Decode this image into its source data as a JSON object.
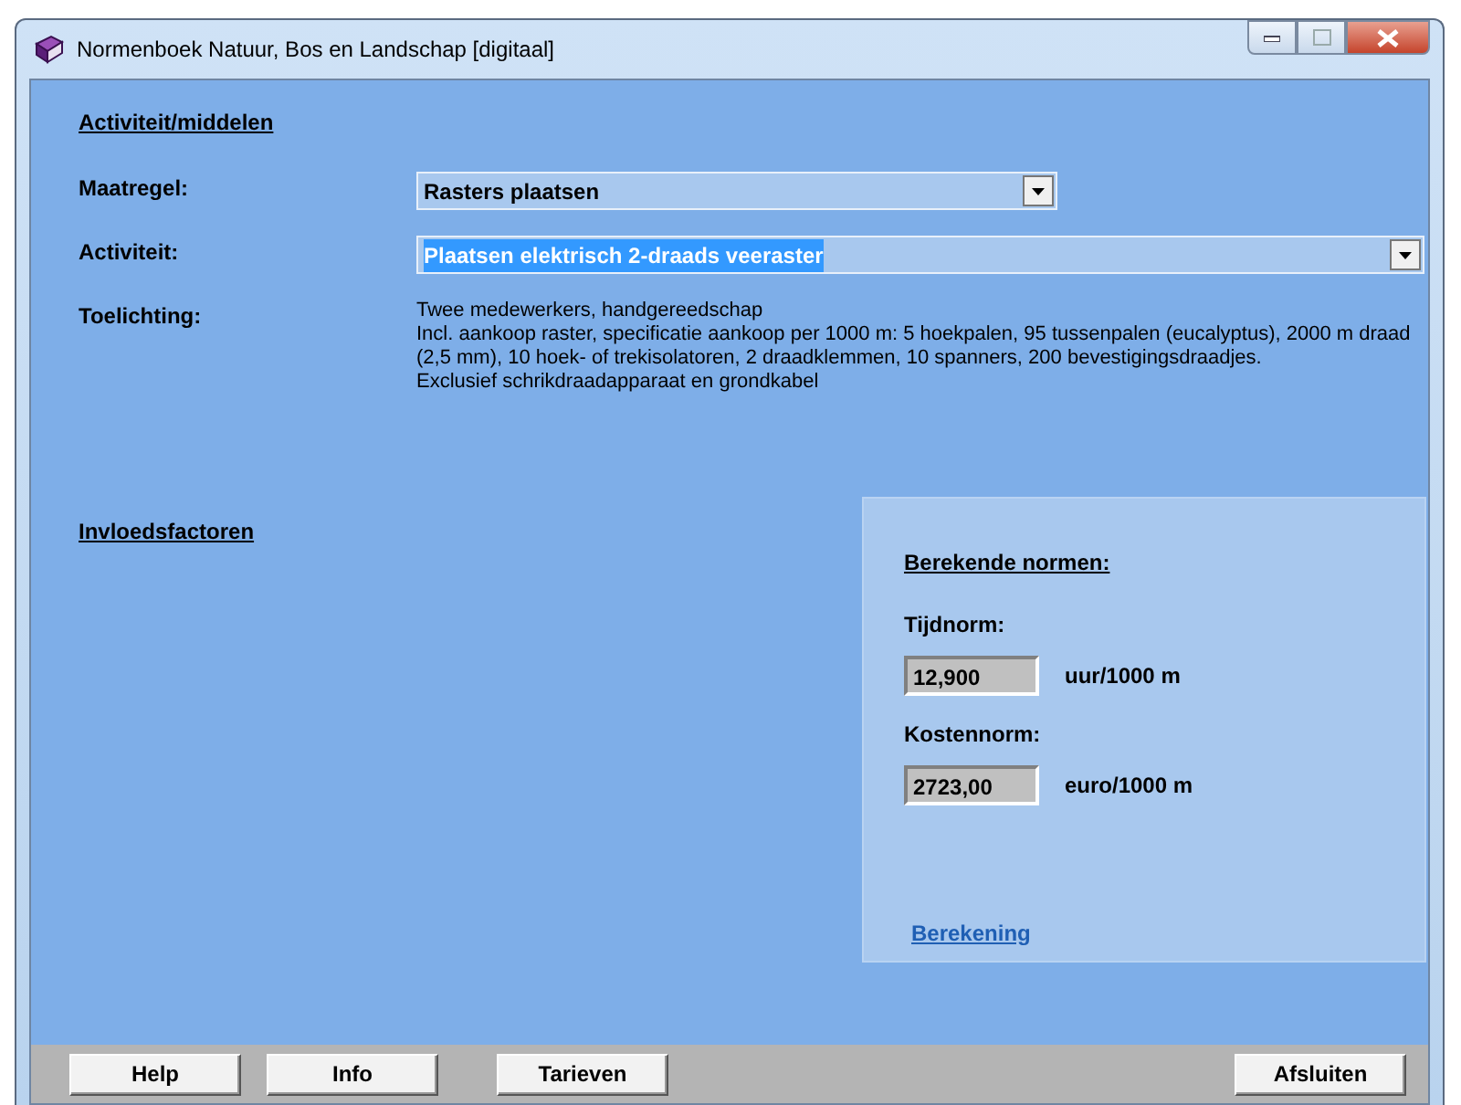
{
  "window": {
    "title": "Normenboek Natuur, Bos en Landschap [digitaal]"
  },
  "section_title": "Activiteit/middelen",
  "fields": [
    {
      "kind": "combo",
      "label": "Maatregel:",
      "value": "Rasters plaatsen",
      "highlighted": false
    },
    {
      "kind": "combo",
      "label": "Activiteit:",
      "value": "Plaatsen elektrisch 2-draads veeraster",
      "highlighted": true
    },
    {
      "kind": "text",
      "label": "Toelichting:",
      "lines": [
        "Twee medewerkers, handgereedschap",
        "Incl. aankoop raster, specificatie aankoop per 1000 m: 5 hoekpalen, 95 tussenpalen (eucalyptus), 2000 m draad (2,5 mm), 10 hoek- of trekisolatoren, 2 draadklemmen, 10 spanners, 200 bevestigingsdraadjes.",
        "Exclusief schrikdraadapparaat en grondkabel"
      ]
    }
  ],
  "influence_title": "Invloedsfactoren",
  "results": {
    "title": "Berekende normen:",
    "items": [
      {
        "label": "Tijdnorm:",
        "value": "12,900",
        "unit": "uur/1000 m"
      },
      {
        "label": "Kostennorm:",
        "value": "2723,00",
        "unit": "euro/1000 m"
      }
    ],
    "link": "Berekening"
  },
  "buttons": [
    "Help",
    "Info",
    "Tarieven",
    "Afsluiten"
  ]
}
